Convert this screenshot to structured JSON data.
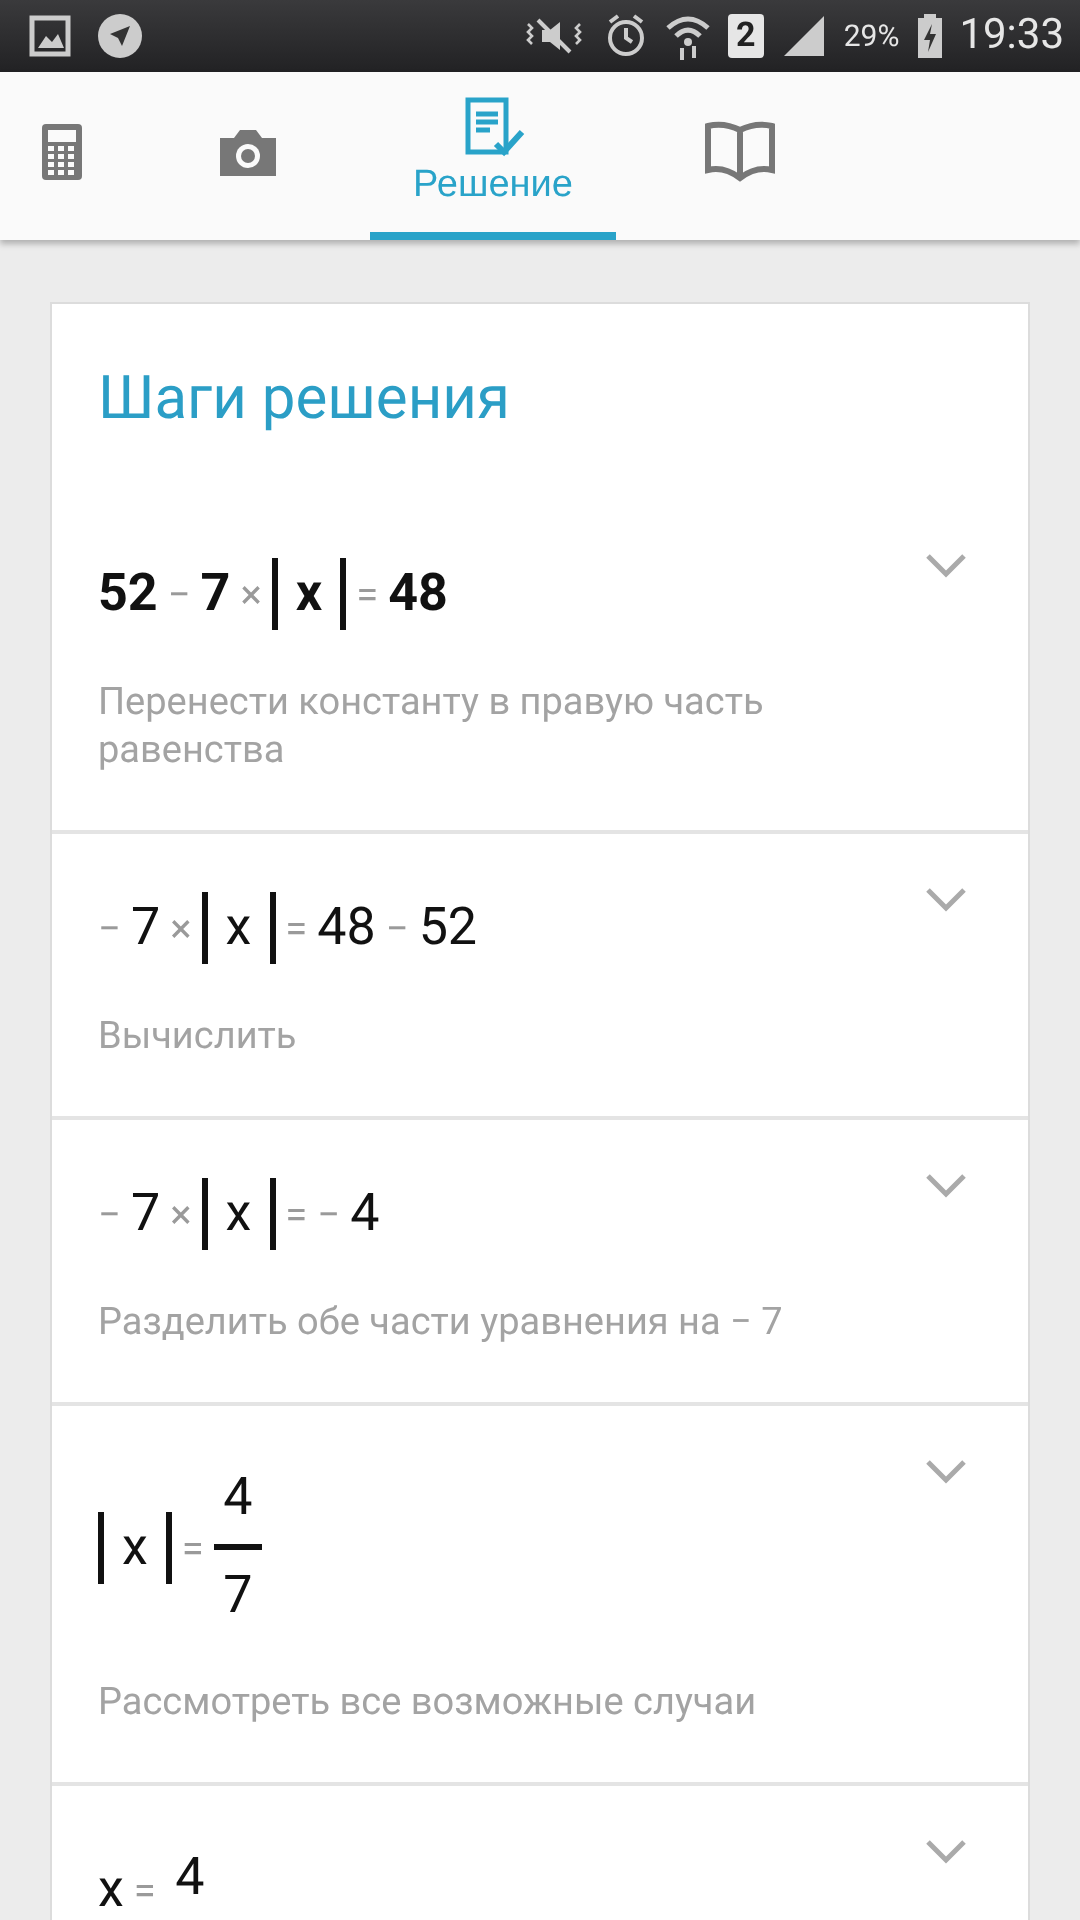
{
  "status_bar": {
    "sim_slot": "2",
    "battery": "29%",
    "time": "19:33"
  },
  "tabs": [
    {
      "kind": "calculator",
      "selected": false
    },
    {
      "kind": "camera",
      "selected": false
    },
    {
      "kind": "solution",
      "label": "Решение",
      "selected": true
    },
    {
      "kind": "book",
      "selected": false
    }
  ],
  "card": {
    "title": "Шаги решения",
    "steps": [
      {
        "bold": true,
        "expanded": false,
        "expression": [
          {
            "kind": "num",
            "text": "52"
          },
          {
            "kind": "op",
            "text": "−"
          },
          {
            "kind": "num",
            "text": "7"
          },
          {
            "kind": "op",
            "text": "×"
          },
          {
            "kind": "abs",
            "text": "x"
          },
          {
            "kind": "op",
            "text": "="
          },
          {
            "kind": "num",
            "text": "48"
          }
        ],
        "description": "Перенести константу в правую часть равенства"
      },
      {
        "bold": false,
        "expanded": false,
        "expression": [
          {
            "kind": "op",
            "text": "−"
          },
          {
            "kind": "num",
            "text": "7"
          },
          {
            "kind": "op",
            "text": "×"
          },
          {
            "kind": "abs",
            "text": "x"
          },
          {
            "kind": "op",
            "text": "="
          },
          {
            "kind": "num",
            "text": "48"
          },
          {
            "kind": "op",
            "text": "−"
          },
          {
            "kind": "num",
            "text": "52"
          }
        ],
        "description": "Вычислить"
      },
      {
        "bold": false,
        "expanded": false,
        "expression": [
          {
            "kind": "op",
            "text": "−"
          },
          {
            "kind": "num",
            "text": "7"
          },
          {
            "kind": "op",
            "text": "×"
          },
          {
            "kind": "abs",
            "text": "x"
          },
          {
            "kind": "op",
            "text": "="
          },
          {
            "kind": "op",
            "text": "−"
          },
          {
            "kind": "num",
            "text": "4"
          }
        ],
        "description": "Разделить обе части уравнения на − 7"
      },
      {
        "bold": false,
        "expanded": false,
        "expression": [
          {
            "kind": "abs",
            "text": "x"
          },
          {
            "kind": "op",
            "text": "="
          },
          {
            "kind": "frac",
            "numerator": "4",
            "denominator": "7"
          }
        ],
        "description": "Рассмотреть все возможные случаи"
      },
      {
        "bold": false,
        "expanded": false,
        "expression": [
          {
            "kind": "num",
            "text": "x"
          },
          {
            "kind": "op",
            "text": "="
          },
          {
            "kind": "frac",
            "numerator": "4"
          }
        ]
      }
    ]
  }
}
